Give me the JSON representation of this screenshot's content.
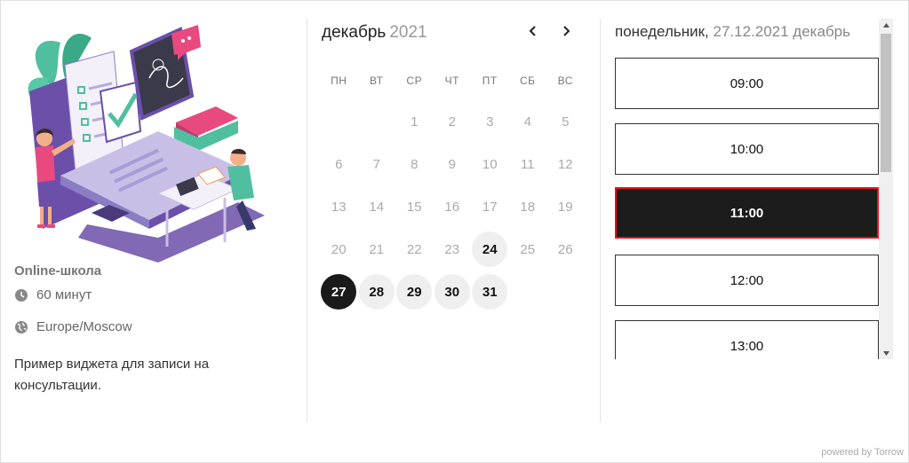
{
  "profile": {
    "school_name": "Online-школа",
    "duration": "60 минут",
    "timezone": "Europe/Moscow",
    "description": "Пример виджета для записи на консультации."
  },
  "calendar": {
    "month": "декабрь",
    "year": "2021",
    "weekdays": [
      "ПН",
      "ВТ",
      "СР",
      "ЧТ",
      "ПТ",
      "СБ",
      "ВС"
    ],
    "weeks": [
      [
        "",
        "",
        "1",
        "2",
        "3",
        "4",
        "5"
      ],
      [
        "6",
        "7",
        "8",
        "9",
        "10",
        "11",
        "12"
      ],
      [
        "13",
        "14",
        "15",
        "16",
        "17",
        "18",
        "19"
      ],
      [
        "20",
        "21",
        "22",
        "23",
        "24",
        "25",
        "26"
      ],
      [
        "27",
        "28",
        "29",
        "30",
        "31",
        "",
        ""
      ]
    ],
    "available_days": [
      "24",
      "27",
      "28",
      "29",
      "30",
      "31"
    ],
    "selected_day": "27"
  },
  "slots": {
    "weekday": "понедельник",
    "date_text": "27.12.2021 декабрь",
    "times": [
      "09:00",
      "10:00",
      "11:00",
      "12:00",
      "13:00"
    ],
    "active_time": "11:00"
  },
  "footer": {
    "powered": "powered by Torrow"
  },
  "colors": {
    "selected_bg": "#1a1a1a",
    "active_border": "#ee1111",
    "available_bg": "#efefef"
  }
}
